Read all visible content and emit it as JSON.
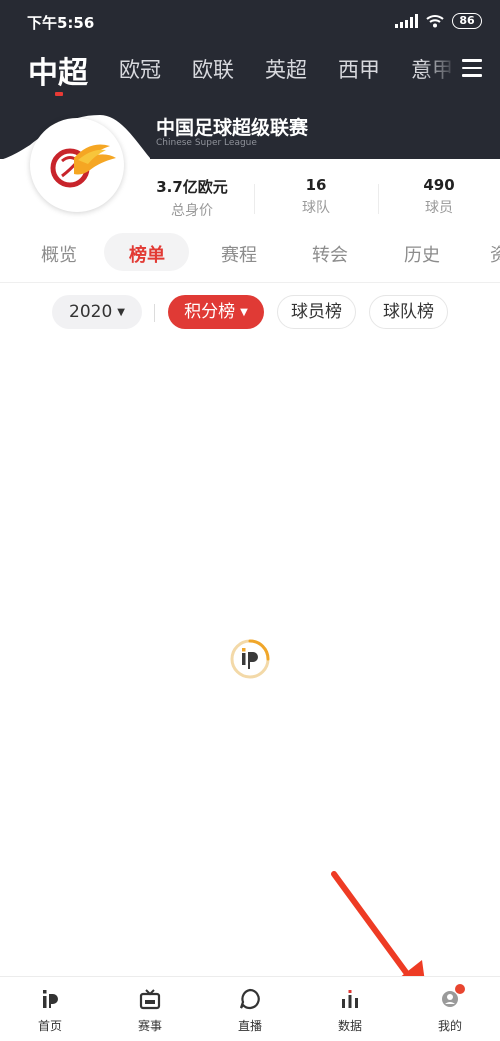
{
  "status_bar": {
    "time": "下午5:56",
    "battery": "86",
    "icons": [
      "signal-icon",
      "wifi-icon",
      "battery-icon"
    ]
  },
  "league_tabs": [
    "中超",
    "欧冠",
    "欧联",
    "英超",
    "西甲",
    "意甲"
  ],
  "league_tabs_active": "中超",
  "league": {
    "name": "中国足球超级联赛",
    "subtitle": "Chinese Super League"
  },
  "stats": [
    {
      "value": "3.7亿欧元",
      "label": "总身价"
    },
    {
      "value": "16",
      "label": "球队"
    },
    {
      "value": "490",
      "label": "球员"
    }
  ],
  "section_tabs": [
    "概览",
    "榜单",
    "赛程",
    "转会",
    "历史",
    "资"
  ],
  "section_tabs_active": "榜单",
  "filters": {
    "season": "2020",
    "active": "积分榜",
    "others": [
      "球员榜",
      "球队榜"
    ]
  },
  "bottom_nav": [
    {
      "label": "首页",
      "icon": "home-logo-icon"
    },
    {
      "label": "赛事",
      "icon": "tv-icon"
    },
    {
      "label": "直播",
      "icon": "chat-bubble-icon"
    },
    {
      "label": "数据",
      "icon": "bar-chart-icon"
    },
    {
      "label": "我的",
      "icon": "profile-icon"
    }
  ],
  "colors": {
    "header_bg": "#272a33",
    "accent": "#e03a35",
    "loader": "#f0a62a"
  }
}
